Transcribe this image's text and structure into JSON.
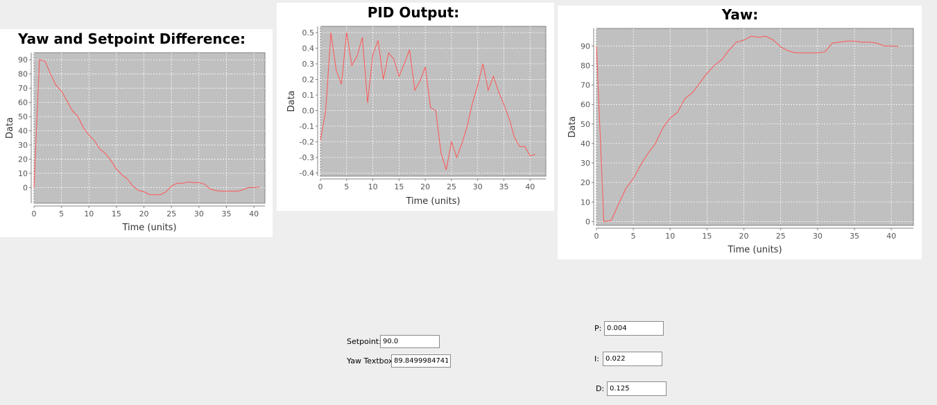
{
  "chart_data": [
    {
      "type": "line",
      "title": "Yaw and Setpoint Difference:",
      "xlabel": "Time (units)",
      "ylabel": "Data",
      "xlim": [
        0,
        42
      ],
      "ylim": [
        -11,
        95
      ],
      "xticks": [
        0,
        5,
        10,
        15,
        20,
        25,
        30,
        35,
        40
      ],
      "yticks": [
        0,
        10,
        20,
        30,
        40,
        50,
        60,
        70,
        80,
        90
      ],
      "grid": true,
      "color": "#ff5555",
      "x": [
        0,
        1,
        2,
        3,
        4,
        5,
        6,
        7,
        8,
        9,
        10,
        11,
        12,
        13,
        14,
        15,
        16,
        17,
        18,
        19,
        20,
        21,
        22,
        23,
        24,
        25,
        26,
        27,
        28,
        29,
        30,
        31,
        32,
        33,
        34,
        35,
        36,
        37,
        38,
        39,
        40,
        41
      ],
      "values": [
        0,
        90,
        89,
        80,
        72,
        68,
        61,
        54,
        50,
        42,
        37,
        33,
        27,
        24,
        19,
        13,
        9,
        6,
        1,
        -2,
        -3,
        -5,
        -5,
        -5,
        -3,
        1,
        3,
        3,
        4,
        3.5,
        3.5,
        2.5,
        -1,
        -2,
        -2.5,
        -2.5,
        -2.5,
        -2.5,
        -1.5,
        0,
        0,
        0.5
      ]
    },
    {
      "type": "line",
      "title": "PID Output:",
      "xlabel": "Time (units)",
      "ylabel": "Data",
      "xlim": [
        0,
        43
      ],
      "ylim": [
        -0.42,
        0.54
      ],
      "xticks": [
        0,
        5,
        10,
        15,
        20,
        25,
        30,
        35,
        40
      ],
      "yticks": [
        -0.4,
        -0.3,
        -0.2,
        -0.1,
        0.0,
        0.1,
        0.2,
        0.3,
        0.4,
        0.5
      ],
      "ytick_labels": [
        "-0.4",
        "-0.3",
        "-0.2",
        "-0.1",
        "0.0",
        "0.1",
        "0.2",
        "0.3",
        "0.4",
        "0.5"
      ],
      "grid": true,
      "color": "#ff5555",
      "x": [
        0,
        1,
        2,
        3,
        4,
        5,
        6,
        7,
        8,
        9,
        10,
        11,
        12,
        13,
        14,
        15,
        16,
        17,
        18,
        19,
        20,
        21,
        22,
        23,
        24,
        25,
        26,
        27,
        28,
        29,
        30,
        31,
        32,
        33,
        34,
        35,
        36,
        37,
        38,
        39,
        40,
        41
      ],
      "values": [
        -0.19,
        0.0,
        0.5,
        0.26,
        0.17,
        0.5,
        0.29,
        0.35,
        0.47,
        0.05,
        0.36,
        0.45,
        0.2,
        0.37,
        0.33,
        0.22,
        0.3,
        0.39,
        0.13,
        0.19,
        0.28,
        0.02,
        0.0,
        -0.27,
        -0.38,
        -0.2,
        -0.3,
        -0.21,
        -0.1,
        0.05,
        0.16,
        0.3,
        0.13,
        0.22,
        0.12,
        0.04,
        -0.05,
        -0.17,
        -0.23,
        -0.23,
        -0.29,
        -0.28
      ]
    },
    {
      "type": "line",
      "title": "Yaw:",
      "xlabel": "Time (units)",
      "ylabel": "Data",
      "xlim": [
        0,
        43
      ],
      "ylim": [
        -2,
        99
      ],
      "xticks": [
        0,
        5,
        10,
        15,
        20,
        25,
        30,
        35,
        40
      ],
      "yticks": [
        0,
        10,
        20,
        30,
        40,
        50,
        60,
        70,
        80,
        90
      ],
      "grid": true,
      "color": "#ff5555",
      "x": [
        0,
        1,
        2,
        3,
        4,
        5,
        6,
        7,
        8,
        9,
        10,
        11,
        12,
        13,
        14,
        15,
        16,
        17,
        18,
        19,
        20,
        21,
        22,
        23,
        24,
        25,
        26,
        27,
        28,
        29,
        30,
        31,
        32,
        33,
        34,
        35,
        36,
        37,
        38,
        39,
        40,
        41
      ],
      "values": [
        90,
        0,
        0.5,
        9,
        17,
        22,
        29,
        35,
        40,
        48,
        53,
        56,
        63,
        66,
        71,
        76,
        80,
        83,
        88,
        92,
        93,
        95,
        94.5,
        95,
        93,
        89.5,
        87.5,
        86.5,
        86.5,
        86.5,
        86.5,
        87,
        91.5,
        92,
        92.5,
        92.5,
        92,
        92,
        91.5,
        90,
        90,
        89.8
      ]
    }
  ],
  "controls": {
    "setpoint": {
      "label": "Setpoint:",
      "value": "90.0"
    },
    "yaw_textbox": {
      "label": "Yaw Textbox",
      "value": "89.84999847412"
    },
    "p": {
      "label": "P:",
      "value": "0.004"
    },
    "i": {
      "label": "I:",
      "value": "0.022"
    },
    "d": {
      "label": "D:",
      "value": "0.125"
    }
  }
}
